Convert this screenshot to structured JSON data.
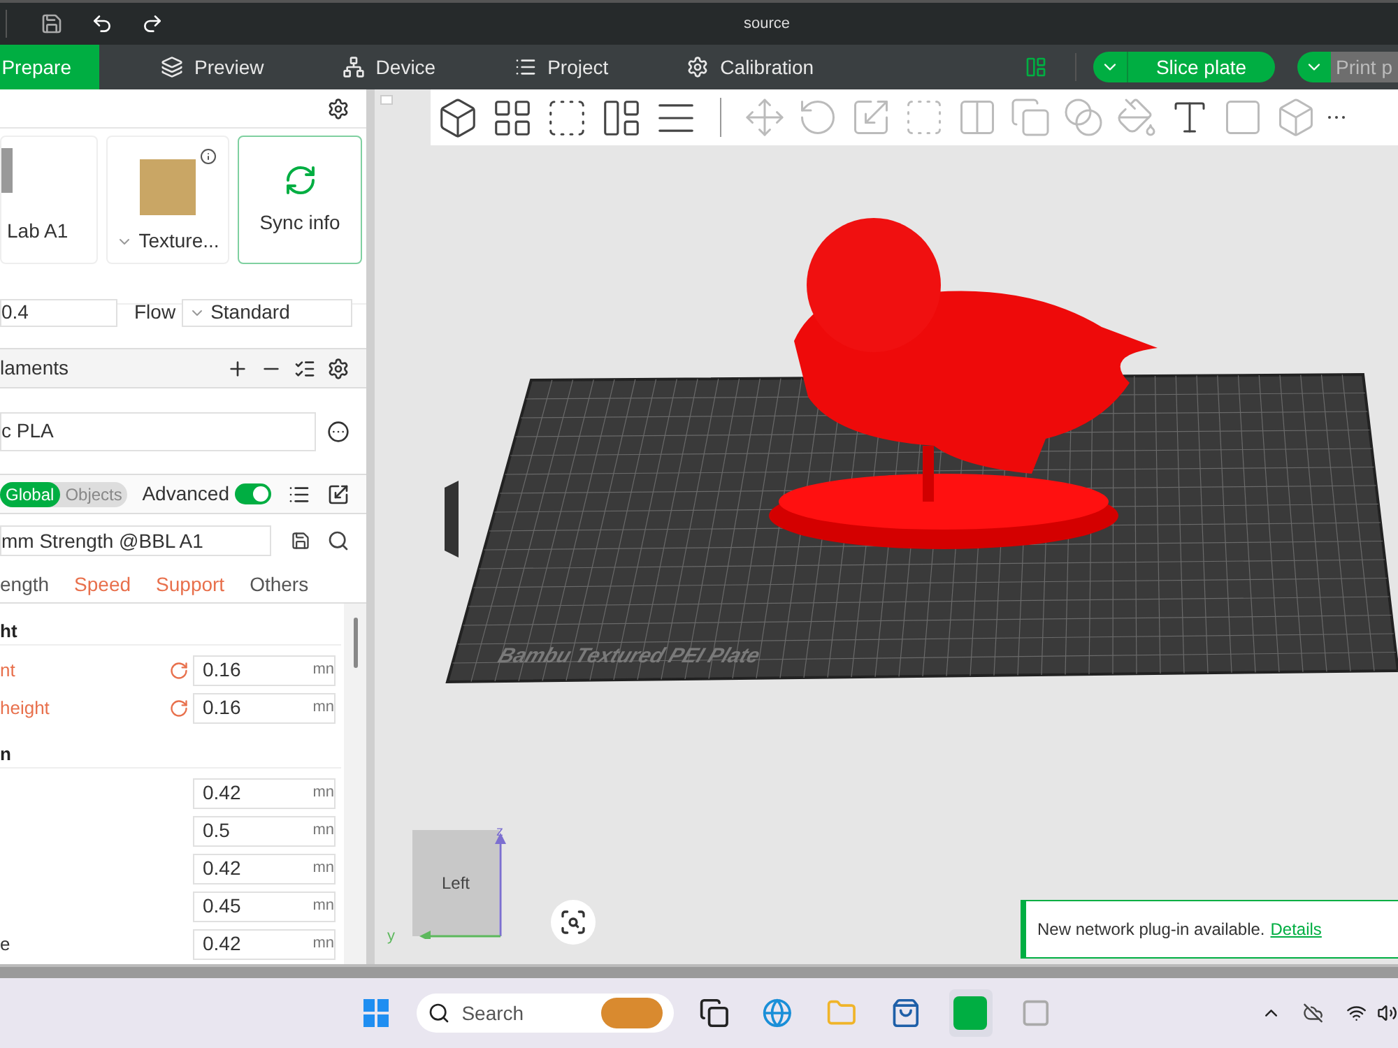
{
  "window": {
    "title": "source"
  },
  "tabs": [
    {
      "label": "Prepare",
      "selected": true
    },
    {
      "label": "Preview",
      "selected": false
    },
    {
      "label": "Device",
      "selected": false
    },
    {
      "label": "Project",
      "selected": false
    },
    {
      "label": "Calibration",
      "selected": false
    }
  ],
  "actions": {
    "slice": "Slice plate",
    "print": "Print p"
  },
  "printer": {
    "name": "Lab A1",
    "plate": "Texture...",
    "sync": "Sync info",
    "nozzle": "0.4",
    "flow_label": "Flow",
    "flow": "Standard"
  },
  "filaments": {
    "title": "laments",
    "items": [
      "c PLA"
    ]
  },
  "process": {
    "scope": [
      {
        "label": "Global",
        "selected": true
      },
      {
        "label": "Objects",
        "selected": false
      }
    ],
    "advanced_label": "Advanced",
    "advanced": true,
    "preset": "mm Strength @BBL A1",
    "tabs": [
      {
        "label": "ength",
        "modified": false
      },
      {
        "label": "Speed",
        "modified": true
      },
      {
        "label": "Support",
        "modified": true
      },
      {
        "label": "Others",
        "modified": false
      }
    ],
    "sections": [
      {
        "title": "ht",
        "rows": [
          {
            "label": "nt",
            "value": "0.16",
            "unit": "mn",
            "modified": true
          },
          {
            "label": " height",
            "value": "0.16",
            "unit": "mn",
            "modified": true
          }
        ]
      },
      {
        "title": "n",
        "rows": [
          {
            "value": "0.42",
            "unit": "mn",
            "modified": false
          },
          {
            "value": "0.5",
            "unit": "mn",
            "modified": false
          },
          {
            "value": "0.42",
            "unit": "mn",
            "modified": false
          },
          {
            "value": "0.45",
            "unit": "mn",
            "modified": false
          },
          {
            "label": "e",
            "value": "0.42",
            "unit": "mn",
            "modified": false
          }
        ]
      }
    ]
  },
  "viewport": {
    "plate_label": "Bambu Textured PEI Plate",
    "view_cube": "Left",
    "axes": [
      "z",
      "y"
    ]
  },
  "notification": {
    "text": "New network plug-in available.",
    "link": "Details"
  },
  "taskbar": {
    "search_placeholder": "Search"
  }
}
